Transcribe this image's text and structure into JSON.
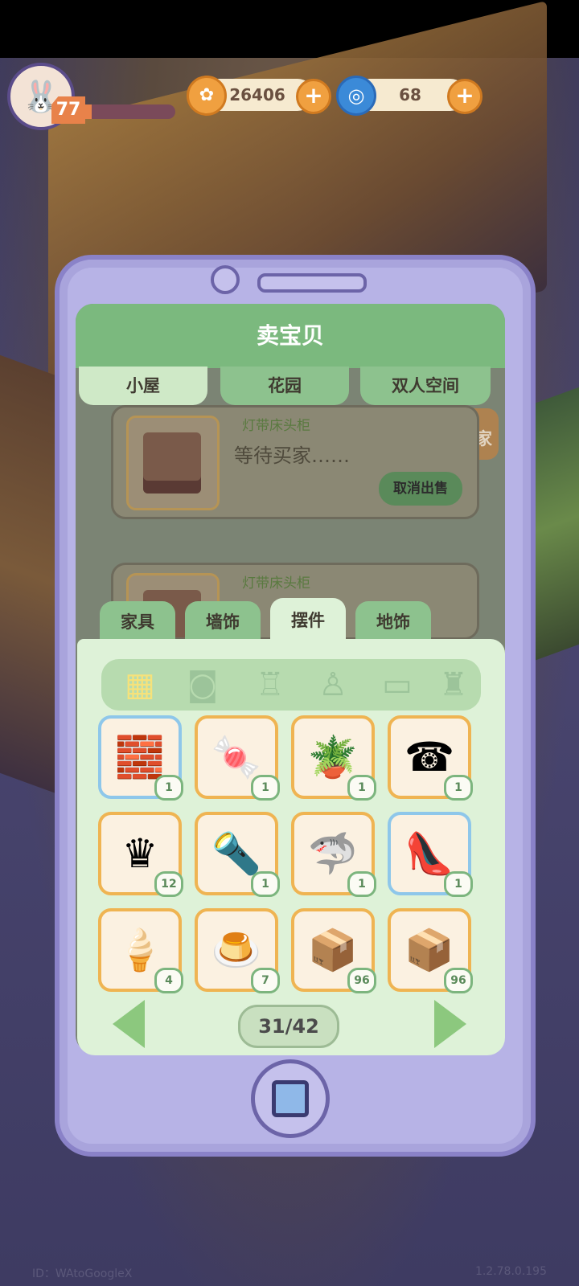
{
  "hud": {
    "level": "77",
    "coins": "26406",
    "gems": "68",
    "plus_label": "+"
  },
  "phone": {
    "title": "卖宝贝",
    "top_tabs": [
      "小屋",
      "花园",
      "双人空间"
    ],
    "sale_items": [
      {
        "name": "灯带床头柜",
        "status": "等待买家……",
        "cancel_label": "取消出售"
      },
      {
        "name": "灯带床头柜"
      }
    ],
    "summon_label": "呼唤买家",
    "category_tabs": [
      "家具",
      "墙饰",
      "摆件",
      "地饰"
    ],
    "active_category": "摆件",
    "subcategory_icons": [
      "grid-icon",
      "pot-icon",
      "cup-icon",
      "lamp-icon",
      "pillow-icon",
      "bottle-icon"
    ],
    "items": [
      {
        "icon": "building-blocks-icon",
        "qty": "1"
      },
      {
        "icon": "gumball-machine-icon",
        "qty": "1"
      },
      {
        "icon": "plant-pots-icon",
        "qty": "1"
      },
      {
        "icon": "telephone-icon",
        "qty": "1"
      },
      {
        "icon": "chess-queen-icon",
        "qty": "12"
      },
      {
        "icon": "flashlight-icon",
        "qty": "1"
      },
      {
        "icon": "shark-plush-icon",
        "qty": "1"
      },
      {
        "icon": "pink-shoe-icon",
        "qty": "1"
      },
      {
        "icon": "ice-cream-plate-icon",
        "qty": "4"
      },
      {
        "icon": "jelly-pudding-icon",
        "qty": "7"
      },
      {
        "icon": "cardboard-box-icon",
        "qty": "96"
      },
      {
        "icon": "cardboard-box-icon",
        "qty": "96"
      }
    ],
    "page": "31/42"
  },
  "footer": {
    "left": "ID：WAtoGoogleX",
    "right": "1.2.78.0.195"
  }
}
